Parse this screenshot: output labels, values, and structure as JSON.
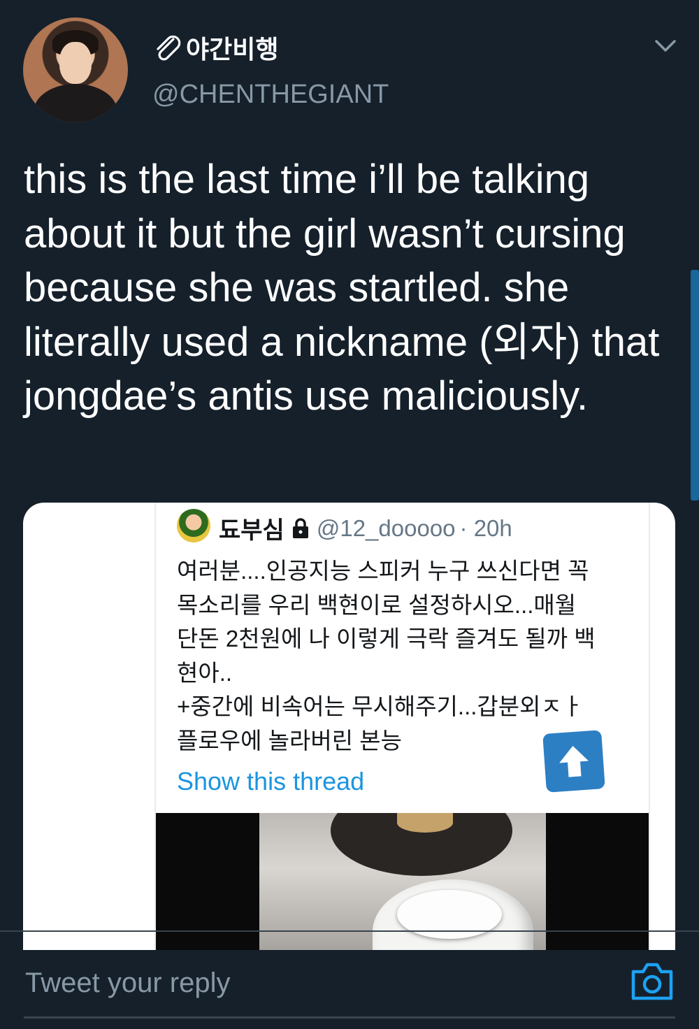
{
  "tweet": {
    "display_name": "야간비행",
    "handle": "@CHENTHEGIANT",
    "text": "this is the last time i’ll be talking about it but the girl wasn’t cursing because she was startled. she literally used a nickname (외자) that jongdae’s antis use maliciously."
  },
  "quoted": {
    "name": "됴부심",
    "handle": "@12_dooooo",
    "time": "· 20h",
    "body": "여러분....인공지능 스피커 누구 쓰신다면 꼭\n목소리를 우리 백현이로 설정하시오...매월\n단돈 2천원에 나 이렇게 극락 즐겨도 될까 백\n현아..\n+중간에 비속어는 무시해주기...갑분외ㅈㅏ\n플로우에 놀라버린 본능",
    "show_thread": "Show this thread"
  },
  "reply": {
    "placeholder": "Tweet your reply"
  },
  "icons": {
    "more": "chevron-down-icon",
    "verified_link": "paperclip-icon",
    "lock": "lock-icon",
    "up": "arrow-up-icon",
    "camera": "camera-icon"
  },
  "colors": {
    "background": "#15202b",
    "accent": "#1da1f2",
    "secondary_text": "#8899a6",
    "link": "#1b95e0"
  }
}
